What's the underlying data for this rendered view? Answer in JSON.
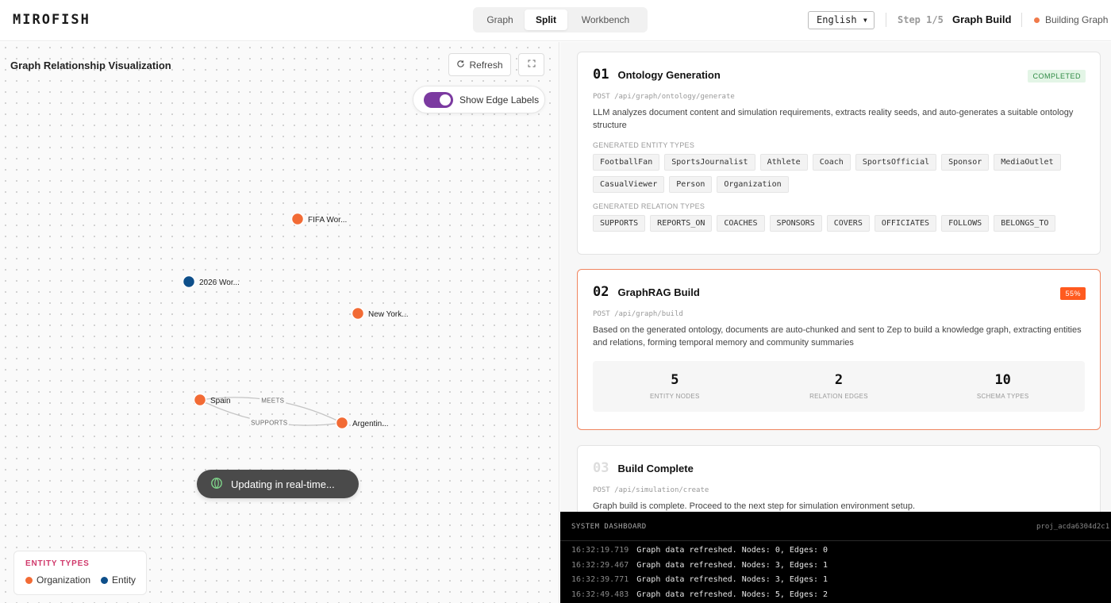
{
  "header": {
    "brand": "MIROFISH",
    "views": [
      "Graph",
      "Split",
      "Workbench"
    ],
    "active_view": "Split",
    "language": "English ▾",
    "step_label": "Step 1/5",
    "step_name": "Graph Build",
    "status": "Building Graph",
    "status_color": "#f07a4a"
  },
  "graph": {
    "title": "Graph Relationship Visualization",
    "refresh_label": "Refresh",
    "toggle_label": "Show Edge Labels",
    "toggle_on": true,
    "updating_text": "Updating in real-time...",
    "nodes": [
      {
        "id": "fifa",
        "label": "FIFA Wor...",
        "type": "Organization"
      },
      {
        "id": "wc2026",
        "label": "2026 Wor...",
        "type": "Entity"
      },
      {
        "id": "newyork",
        "label": "New York...",
        "type": "Organization"
      },
      {
        "id": "spain",
        "label": "Spain",
        "type": "Organization"
      },
      {
        "id": "argentina",
        "label": "Argentin...",
        "type": "Organization"
      }
    ],
    "edges": [
      {
        "source": "spain",
        "target": "argentina",
        "label": "MEETS"
      },
      {
        "source": "spain",
        "target": "argentina",
        "label": "SUPPORTS"
      }
    ],
    "legend": {
      "title": "ENTITY TYPES",
      "items": [
        {
          "label": "Organization",
          "color": "#f26b35"
        },
        {
          "label": "Entity",
          "color": "#0e4f8a"
        }
      ]
    }
  },
  "steps": [
    {
      "num": "01",
      "title": "Ontology Generation",
      "badge": "COMPLETED",
      "endpoint": "POST /api/graph/ontology/generate",
      "desc": "LLM analyzes document content and simulation requirements, extracts reality seeds, and auto-generates a suitable ontology structure",
      "entity_types_label": "GENERATED ENTITY TYPES",
      "entity_types": [
        "FootballFan",
        "SportsJournalist",
        "Athlete",
        "Coach",
        "SportsOfficial",
        "Sponsor",
        "MediaOutlet",
        "CasualViewer",
        "Person",
        "Organization"
      ],
      "relation_types_label": "GENERATED RELATION TYPES",
      "relation_types": [
        "SUPPORTS",
        "REPORTS_ON",
        "COACHES",
        "SPONSORS",
        "COVERS",
        "OFFICIATES",
        "FOLLOWS",
        "BELONGS_TO"
      ]
    },
    {
      "num": "02",
      "title": "GraphRAG Build",
      "badge": "55%",
      "endpoint": "POST /api/graph/build",
      "desc": "Based on the generated ontology, documents are auto-chunked and sent to Zep to build a knowledge graph, extracting entities and relations, forming temporal memory and community summaries",
      "stats": [
        {
          "value": "5",
          "label": "ENTITY NODES"
        },
        {
          "value": "2",
          "label": "RELATION EDGES"
        },
        {
          "value": "10",
          "label": "SCHEMA TYPES"
        }
      ]
    },
    {
      "num": "03",
      "title": "Build Complete",
      "endpoint": "POST /api/simulation/create",
      "desc": "Graph build is complete. Proceed to the next step for simulation environment setup."
    }
  ],
  "dashboard": {
    "title": "SYSTEM DASHBOARD",
    "project": "proj_acda6304d2c1",
    "logs": [
      {
        "time": "16:32:19.719",
        "msg": "Graph data refreshed. Nodes: 0, Edges: 0"
      },
      {
        "time": "16:32:29.467",
        "msg": "Graph data refreshed. Nodes: 3, Edges: 1"
      },
      {
        "time": "16:32:39.771",
        "msg": "Graph data refreshed. Nodes: 3, Edges: 1"
      },
      {
        "time": "16:32:49.483",
        "msg": "Graph data refreshed. Nodes: 5, Edges: 2"
      }
    ]
  }
}
